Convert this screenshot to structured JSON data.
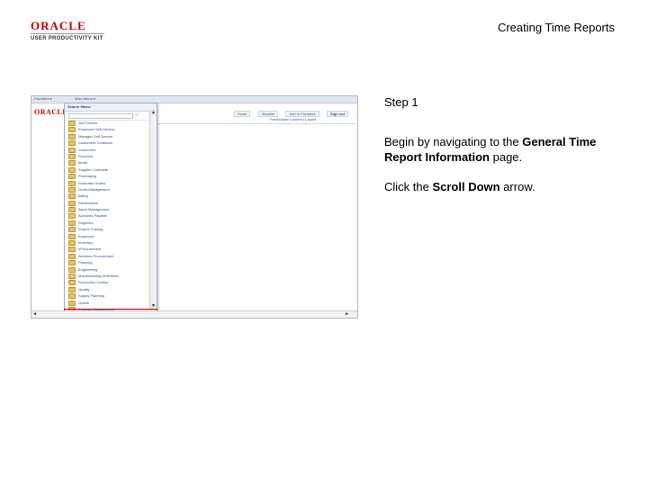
{
  "logo": {
    "brand": "ORACLE",
    "product": "USER PRODUCTIVITY KIT"
  },
  "doc_title": "Creating Time Reports",
  "screenshot": {
    "topbar": {
      "favorites": "Favorites ▾",
      "main_menu": "Main Menu ▾"
    },
    "brand": "ORACLE",
    "header_links": [
      "Home",
      "Worklist",
      "Add to Favorites"
    ],
    "signout": "Sign out",
    "subheader": "Personalize Content  |  Layout",
    "menu": {
      "title": "Search Menu:",
      "search_icon": "search-icon",
      "items": [
        "Self Service",
        "Employee Self-Service",
        "Manager Self Service",
        "Customers Contracts",
        "Customers",
        "Products",
        "Items",
        "Supplier Contracts",
        "Purchasing",
        "Purchase Orders",
        "Order Management",
        "Billing",
        "Receivables",
        "Asset Management",
        "Accounts Payable",
        "Suppliers",
        "Project Costing",
        "Expenses",
        "Inventory",
        "eProcurement",
        "Services Procurement",
        "Planning",
        "Engineering",
        "Manufacturing Definitions",
        "Production Control",
        "Quality",
        "Supply Planning",
        "Grants",
        "Program Management",
        "Project Cost"
      ],
      "submenu_flags": [
        true,
        true,
        true,
        true,
        false,
        false,
        true,
        true,
        true,
        true,
        true,
        true,
        true,
        true,
        true,
        true,
        true,
        true,
        true,
        true,
        true,
        false,
        false,
        true,
        true,
        false,
        true,
        false,
        true,
        false
      ]
    }
  },
  "step_title": "Step 1",
  "step_text": {
    "before": "Begin by navigating to the ",
    "strong": "General Time Report Information",
    "after": " page."
  },
  "step_action": {
    "before": "Click the ",
    "strong": "Scroll Down",
    "after": " arrow."
  }
}
